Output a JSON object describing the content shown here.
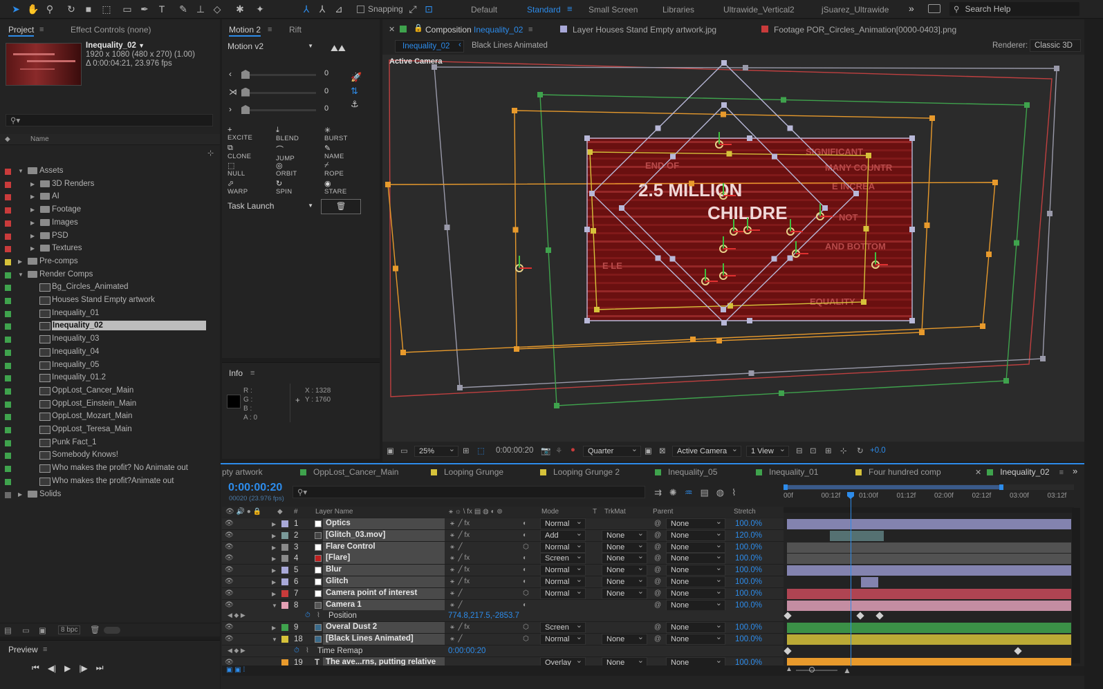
{
  "toolbar": {
    "snapping": "Snapping",
    "workspaces": [
      "Default",
      "Standard",
      "Small Screen",
      "Libraries",
      "Ultrawide_Vertical2",
      "jSuarez_Ultrawide"
    ],
    "active_workspace": "Standard",
    "search_placeholder": "Search Help",
    "more": "»"
  },
  "project": {
    "tab": "Project",
    "effect_controls": "Effect Controls (none)",
    "comp_name": "Inequality_02",
    "comp_dims": "1920 x 1080  (480 x 270) (1.00)",
    "comp_duration": "Δ 0:00:04:21, 23.976 fps",
    "col_name": "Name",
    "bpc": "8 bpc",
    "items": [
      {
        "label": "Assets",
        "depth": 0,
        "type": "folder",
        "open": true,
        "color": "#c93b3b"
      },
      {
        "label": "3D Renders",
        "depth": 1,
        "type": "folder",
        "open": false,
        "color": "#c93b3b"
      },
      {
        "label": "AI",
        "depth": 1,
        "type": "folder",
        "open": false,
        "color": "#c93b3b"
      },
      {
        "label": "Footage",
        "depth": 1,
        "type": "folder",
        "open": false,
        "color": "#c93b3b"
      },
      {
        "label": "Images",
        "depth": 1,
        "type": "folder",
        "open": false,
        "color": "#c93b3b"
      },
      {
        "label": "PSD",
        "depth": 1,
        "type": "folder",
        "open": false,
        "color": "#c93b3b"
      },
      {
        "label": "Textures",
        "depth": 1,
        "type": "folder",
        "open": false,
        "color": "#c93b3b"
      },
      {
        "label": "Pre-comps",
        "depth": 0,
        "type": "folder",
        "open": false,
        "color": "#d6c23a"
      },
      {
        "label": "Render Comps",
        "depth": 0,
        "type": "folder",
        "open": true,
        "color": "#3fa34d"
      },
      {
        "label": "Bg_Circles_Animated",
        "depth": 1,
        "type": "comp",
        "color": "#3fa34d"
      },
      {
        "label": "Houses Stand Empty artwork",
        "depth": 1,
        "type": "comp",
        "color": "#3fa34d"
      },
      {
        "label": "Inequality_01",
        "depth": 1,
        "type": "comp",
        "color": "#3fa34d"
      },
      {
        "label": "Inequality_02",
        "depth": 1,
        "type": "comp",
        "color": "#3fa34d",
        "selected": true
      },
      {
        "label": "Inequality_03",
        "depth": 1,
        "type": "comp",
        "color": "#3fa34d"
      },
      {
        "label": "Inequality_04",
        "depth": 1,
        "type": "comp",
        "color": "#3fa34d"
      },
      {
        "label": "Inequality_05",
        "depth": 1,
        "type": "comp",
        "color": "#3fa34d"
      },
      {
        "label": "Inequality_01.2",
        "depth": 1,
        "type": "comp",
        "color": "#3fa34d"
      },
      {
        "label": "OppLost_Cancer_Main",
        "depth": 1,
        "type": "comp",
        "color": "#3fa34d"
      },
      {
        "label": "OppLost_Einstein_Main",
        "depth": 1,
        "type": "comp",
        "color": "#3fa34d"
      },
      {
        "label": "OppLost_Mozart_Main",
        "depth": 1,
        "type": "comp",
        "color": "#3fa34d"
      },
      {
        "label": "OppLost_Teresa_Main",
        "depth": 1,
        "type": "comp",
        "color": "#3fa34d"
      },
      {
        "label": "Punk Fact_1",
        "depth": 1,
        "type": "comp",
        "color": "#3fa34d"
      },
      {
        "label": "Somebody Knows!",
        "depth": 1,
        "type": "comp",
        "color": "#3fa34d"
      },
      {
        "label": "Who makes the profit? No Animate out",
        "depth": 1,
        "type": "comp",
        "color": "#3fa34d"
      },
      {
        "label": "Who makes the profit?Animate out",
        "depth": 1,
        "type": "comp",
        "color": "#3fa34d"
      },
      {
        "label": "Solids",
        "depth": 0,
        "type": "folder",
        "open": false,
        "color": "#6a6a6a"
      }
    ]
  },
  "motion": {
    "tab": "Motion 2",
    "tab2": "Rift",
    "preset": "Motion v2",
    "slider_values": [
      "0",
      "0",
      "0"
    ],
    "buttons": [
      [
        "EXCITE",
        "BLEND",
        "BURST"
      ],
      [
        "CLONE",
        "JUMP",
        "NAME"
      ],
      [
        "NULL",
        "ORBIT",
        "ROPE"
      ],
      [
        "WARP",
        "SPIN",
        "STARE"
      ]
    ],
    "task": "Task Launch"
  },
  "info": {
    "tab": "Info",
    "r": "R :",
    "g": "G :",
    "b": "B :",
    "a": "A : 0",
    "x": "X : 1328",
    "y": "Y : 1760"
  },
  "preview": {
    "tab": "Preview"
  },
  "composition": {
    "tab_prefix": "Composition",
    "tab_name": "Inequality_02",
    "layer_tab": "Layer Houses Stand Empty artwork.jpg",
    "footage_tab": "Footage POR_Circles_Animation[0000-0403].png",
    "breadcrumb_current": "Inequality_02",
    "breadcrumb_next": "Black Lines Animated",
    "renderer_label": "Renderer:",
    "renderer": "Classic 3D",
    "camera_label": "Active Camera",
    "frame_text": [
      "END OF",
      "2.5 MILLION",
      "CHILDRE",
      "SIGNIFICANT",
      "MANY COUNTR",
      "E INCREA",
      "NOT",
      "AND BOTTOM",
      "E LE",
      "EQUALITY"
    ]
  },
  "viewer_bar": {
    "zoom": "25%",
    "timecode": "0:00:00:20",
    "resolution": "Quarter",
    "camera": "Active Camera",
    "views": "1 View",
    "exposure": "+0.0"
  },
  "timeline": {
    "tabs": [
      {
        "label": "pty artwork",
        "color": null
      },
      {
        "label": "OppLost_Cancer_Main",
        "color": "#3fa34d"
      },
      {
        "label": "Looping Grunge",
        "color": "#d6c23a"
      },
      {
        "label": "Looping Grunge 2",
        "color": "#d6c23a"
      },
      {
        "label": "Inequality_05",
        "color": "#3fa34d"
      },
      {
        "label": "Inequality_01",
        "color": "#3fa34d"
      },
      {
        "label": "Four hundred comp",
        "color": "#d6c23a"
      },
      {
        "label": "Inequality_02",
        "color": "#3fa34d",
        "active": true
      }
    ],
    "timecode": "0:00:00:20",
    "fps": "00020 (23.976 fps)",
    "headers": {
      "num": "#",
      "layer_name": "Layer Name",
      "mode": "Mode",
      "t": "T",
      "trkmat": "TrkMat",
      "parent": "Parent",
      "stretch": "Stretch"
    },
    "ruler": [
      "00f",
      "00:12f",
      "01:00f",
      "01:12f",
      "02:00f",
      "02:12f",
      "03:00f",
      "03:12f"
    ],
    "layers": [
      {
        "num": "1",
        "name": "Optics",
        "label": "#a8a8d8",
        "mode": "Normal",
        "trkmat": "",
        "parent": "None",
        "stretch": "100.0%",
        "bar": "#9494c8",
        "bar_start": 0.0,
        "bar_end": 1.0
      },
      {
        "num": "2",
        "name": "[Glitch_03.mov]",
        "label": "#7a9a9a",
        "mode": "Add",
        "trkmat": "None",
        "parent": "None",
        "stretch": "120.0%",
        "bar": "#5e7f80",
        "bar_start": 0.15,
        "bar_end": 0.34
      },
      {
        "num": "3",
        "name": "Flare Control",
        "label": "#8a8a8a",
        "mode": "Normal",
        "trkmat": "None",
        "parent": "None",
        "stretch": "100.0%",
        "bar": "#5a5a5a",
        "bar_start": 0.0,
        "bar_end": 1.0
      },
      {
        "num": "4",
        "name": "[Flare]",
        "label": "#8a8a8a",
        "mode": "Screen",
        "trkmat": "None",
        "parent": "None",
        "stretch": "100.0%",
        "bar": "#5a5a5a",
        "bar_start": 0.0,
        "bar_end": 1.0
      },
      {
        "num": "5",
        "name": "Blur",
        "label": "#a8a8d8",
        "mode": "Normal",
        "trkmat": "None",
        "parent": "None",
        "stretch": "100.0%",
        "bar": "#9494c8",
        "bar_start": 0.0,
        "bar_end": 1.0
      },
      {
        "num": "6",
        "name": "Glitch",
        "label": "#a8a8d8",
        "mode": "Normal",
        "trkmat": "None",
        "parent": "None",
        "stretch": "100.0%",
        "bar": "#9494c8",
        "bar_start": 0.26,
        "bar_end": 0.32
      },
      {
        "num": "7",
        "name": "Camera point of interest",
        "label": "#c93b3b",
        "mode": "Normal",
        "trkmat": "None",
        "parent": "None",
        "stretch": "100.0%",
        "bar": "#c84a5a",
        "bar_start": 0.0,
        "bar_end": 1.0
      },
      {
        "num": "8",
        "name": "Camera 1",
        "label": "#e4a0b4",
        "mode": "",
        "trkmat": "",
        "parent": "None",
        "stretch": "100.0%",
        "bar": "#e0a0b8",
        "bar_start": 0.0,
        "bar_end": 1.0
      }
    ],
    "position_label": "Position",
    "position_value": "774.8,217.5,-2853.7",
    "layers2": [
      {
        "num": "9",
        "name": "Overal Dust 2",
        "label": "#3fa34d",
        "mode": "Screen",
        "trkmat": "",
        "parent": "None",
        "stretch": "100.0%",
        "bar": "#3fa34d",
        "bar_start": 0.0,
        "bar_end": 1.0
      },
      {
        "num": "18",
        "name": "[Black Lines Animated]",
        "label": "#d6c23a",
        "mode": "Normal",
        "trkmat": "None",
        "parent": "None",
        "stretch": "100.0%",
        "bar": "#d6c23a",
        "bar_start": 0.0,
        "bar_end": 1.0
      }
    ],
    "time_remap_label": "Time Remap",
    "time_remap_value": "0:00:00:20",
    "last_layer": {
      "num": "19",
      "name": "The ave...rns, putting relative",
      "label": "#e89a2c",
      "mode": "Overlay",
      "trkmat": "None",
      "parent": "None",
      "stretch": "100.0%"
    }
  }
}
